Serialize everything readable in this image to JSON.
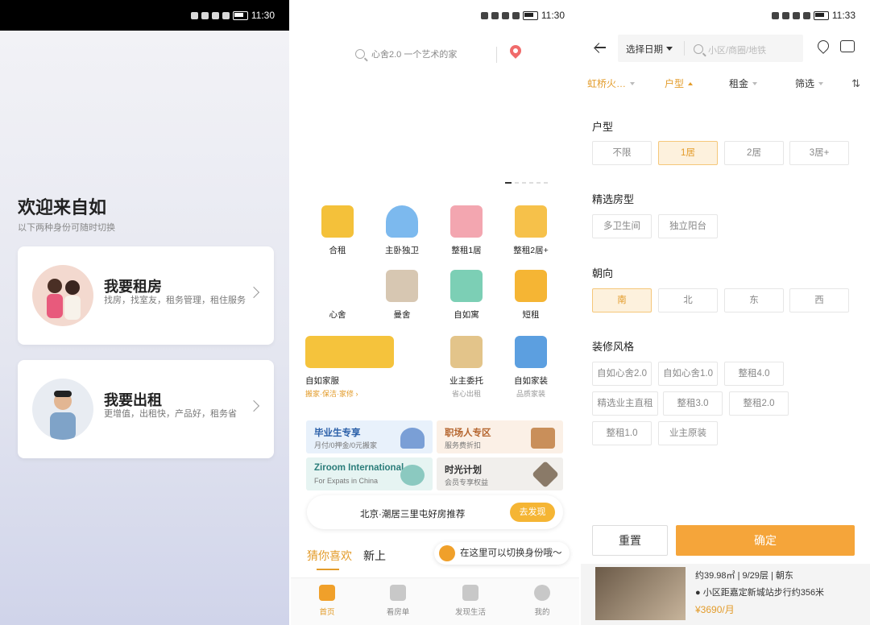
{
  "status": {
    "time1": "11:30",
    "time2": "11:30",
    "time3": "11:33"
  },
  "phone1": {
    "welcome_title": "欢迎来自如",
    "welcome_subtitle": "以下两种身份可随时切换",
    "cards": [
      {
        "title": "我要租房",
        "desc": "找房，找室友，租务管理，租住服务"
      },
      {
        "title": "我要出租",
        "desc": "更增值，出租快，产品好，租务省"
      }
    ]
  },
  "phone2": {
    "search_placeholder": "心舍2.0 一个艺术的家",
    "grid": [
      {
        "label": "合租",
        "sub": ""
      },
      {
        "label": "主卧独卫",
        "sub": ""
      },
      {
        "label": "整租1居",
        "sub": ""
      },
      {
        "label": "整租2居+",
        "sub": ""
      },
      {
        "label": "心舍",
        "sub": ""
      },
      {
        "label": "曼舍",
        "sub": ""
      },
      {
        "label": "自如寓",
        "sub": ""
      },
      {
        "label": "短租",
        "sub": ""
      },
      {
        "label": "自如家服",
        "sub": "搬家·保洁·家修 ›"
      },
      {
        "label": "业主委托",
        "sub": "省心出租"
      },
      {
        "label": "自如家装",
        "sub": "品质家装"
      }
    ],
    "promos": [
      {
        "title": "毕业生专享",
        "sub": "月付/0押金/0元搬家"
      },
      {
        "title": "职场人专区",
        "sub": "服务费折扣"
      },
      {
        "title": "Ziroom International",
        "sub": "For Expats in China"
      },
      {
        "title": "时光计划",
        "sub": "会员专享权益"
      }
    ],
    "discover_text": "北京·潮居三里屯好房推荐",
    "discover_button": "去发现",
    "tabs": [
      "猜你喜欢",
      "新上"
    ],
    "tip": "在这里可以切换身份哦～",
    "nav": [
      "首页",
      "看房单",
      "发现生活",
      "我的"
    ]
  },
  "phone3": {
    "date_select": "选择日期",
    "search_placeholder": "小区/商圈/地铁",
    "filters": [
      "虹桥火…",
      "户型",
      "租金",
      "筛选"
    ],
    "sort_icon": "⇅",
    "sections": {
      "layout": {
        "title": "户型",
        "options": [
          "不限",
          "1居",
          "2居",
          "3居+"
        ],
        "selected": "1居"
      },
      "featured": {
        "title": "精选房型",
        "options": [
          "多卫生间",
          "独立阳台"
        ]
      },
      "orientation": {
        "title": "朝向",
        "options": [
          "南",
          "北",
          "东",
          "西"
        ],
        "selected": "南"
      },
      "decor": {
        "title": "装修风格",
        "options": [
          "自如心舍2.0",
          "自如心舍1.0",
          "整租4.0",
          "精选业主直租",
          "整租3.0",
          "整租2.0",
          "整租1.0",
          "业主原装"
        ]
      }
    },
    "reset": "重置",
    "confirm": "确定",
    "listing": {
      "line1": "约39.98㎡ | 9/29层 | 朝东",
      "line2": "小区距嘉定新城站步行约356米",
      "price": "¥3690/月"
    }
  },
  "colors": {
    "accent": "#e39c2b",
    "button": "#f5a53a"
  }
}
